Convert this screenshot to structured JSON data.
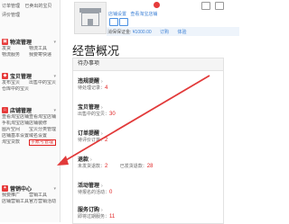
{
  "sidebar": {
    "top_rows": [
      [
        "订单管理",
        "已卖出的宝贝"
      ],
      [
        "评价管理"
      ]
    ],
    "sections": [
      {
        "title": "交易管理",
        "icon_glyph": "¥",
        "rows": [
          [
            "订单管理",
            "已卖出的宝贝"
          ],
          [
            "评价管理"
          ]
        ]
      },
      {
        "title": "物流管理",
        "icon_glyph": "▣",
        "rows": [
          [
            "发货",
            "物流工具"
          ],
          [
            "物流服务",
            "我要寄快递"
          ]
        ]
      },
      {
        "title": "宝贝管理",
        "icon_glyph": "◆",
        "rows": [
          [
            "发布宝贝",
            "出售中的宝贝"
          ],
          [
            "仓库中的宝贝"
          ]
        ]
      },
      {
        "title": "店铺管理",
        "icon_glyph": "⌂",
        "rows": [
          [
            "查看淘宝店铺",
            "查看淘宝店铺"
          ],
          [
            "手机淘宝店铺",
            "店铺装修"
          ],
          [
            "图片空间",
            "宝贝分类管理"
          ],
          [
            "店铺基本设置",
            "域名设置"
          ],
          [
            "淘宝贷款",
            "子账号管理"
          ]
        ]
      },
      {
        "title": "营销中心",
        "icon_glyph": "✦",
        "rows": [
          [
            "我要推广",
            "营销工具"
          ],
          [
            "店铺营销工具",
            "官方营销活动"
          ]
        ]
      }
    ],
    "highlighted_item": "子账号管理"
  },
  "header": {
    "shop_settings": "店铺设置",
    "view_shop": "查看淘宝店铺",
    "deposit_label": "消保保证金:",
    "deposit_amount": "¥1000.00",
    "deposit_link": "订购",
    "deposit_right": "体验"
  },
  "main": {
    "title": "经营概况",
    "panel_header": "待办事项",
    "blocks": [
      {
        "title": "违规提醒",
        "rows": [
          {
            "text": "待处理记录：",
            "num": "4"
          }
        ]
      },
      {
        "title": "宝贝管理",
        "rows": [
          {
            "text": "出售中的宝贝：",
            "num": "30"
          }
        ]
      },
      {
        "title": "订单提醒",
        "rows": [
          {
            "text": "待评价订单：",
            "num": "2"
          }
        ]
      },
      {
        "title": "退款",
        "rows": [
          {
            "text": "未发货退款：",
            "num": "2",
            "text2": "已发货退款：",
            "num2": "28"
          }
        ]
      },
      {
        "title": "活动管理",
        "rows": [
          {
            "text": "待报名的活动：",
            "num": "0"
          }
        ]
      },
      {
        "title": "服务订购",
        "rows": [
          {
            "text": "即将过期服务：",
            "num": "11"
          }
        ]
      }
    ]
  },
  "colors": {
    "accent": "#e63b3b",
    "link": "#3a7fd5",
    "highlight": "#e02020"
  }
}
